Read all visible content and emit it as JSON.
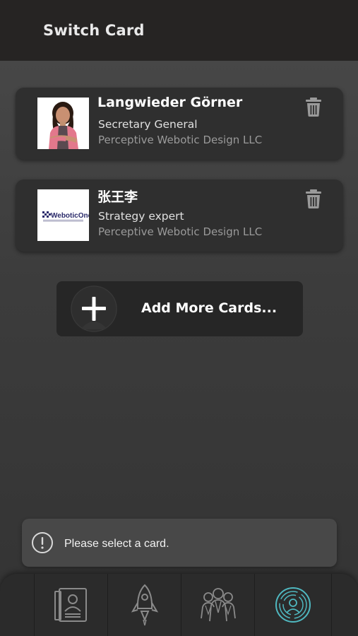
{
  "header": {
    "title": "Switch Card"
  },
  "cards": [
    {
      "name": "Langwieder Görner",
      "role": "Secretary General",
      "company": "Perceptive Webotic Design LLC",
      "thumbnail": "person-photo",
      "delete_icon": "trash-icon"
    },
    {
      "name": "张王李",
      "role": "Strategy expert",
      "company": "Perceptive Webotic Design LLC",
      "thumbnail": "company-logo",
      "logo_text": "WeboticOne",
      "delete_icon": "trash-icon"
    }
  ],
  "add_button": {
    "label": "Add More Cards...",
    "icon": "plus-icon"
  },
  "toast": {
    "message": "Please select a card.",
    "icon": "info-icon"
  },
  "bottom_nav": {
    "items": [
      {
        "icon": "contact-card-icon",
        "active": false
      },
      {
        "icon": "rocket-icon",
        "active": false
      },
      {
        "icon": "team-icon",
        "active": false
      },
      {
        "icon": "profile-circle-icon",
        "active": true
      }
    ]
  },
  "colors": {
    "header_bg": "#262423",
    "card_bg": "#2f2f2f",
    "active_nav": "#4fb8c0",
    "inactive_nav": "#8a8a8a"
  }
}
